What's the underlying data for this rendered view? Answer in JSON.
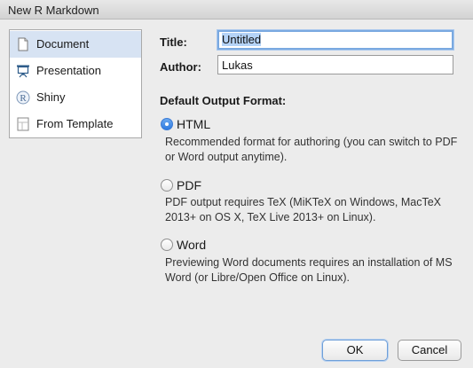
{
  "window": {
    "title": "New R Markdown"
  },
  "sidebar": {
    "items": [
      {
        "label": "Document",
        "icon": "document-icon",
        "selected": true
      },
      {
        "label": "Presentation",
        "icon": "presentation-icon",
        "selected": false
      },
      {
        "label": "Shiny",
        "icon": "shiny-r-icon",
        "selected": false
      },
      {
        "label": "From Template",
        "icon": "template-icon",
        "selected": false
      }
    ]
  },
  "form": {
    "title_label": "Title:",
    "title_value": "Untitled",
    "author_label": "Author:",
    "author_value": "Lukas",
    "output_format_heading": "Default Output Format:"
  },
  "formats": [
    {
      "label": "HTML",
      "checked": true,
      "description": "Recommended format for authoring (you can switch to PDF or Word output anytime)."
    },
    {
      "label": "PDF",
      "checked": false,
      "description": "PDF output requires TeX (MiKTeX on Windows, MacTeX 2013+ on OS X, TeX Live 2013+ on Linux)."
    },
    {
      "label": "Word",
      "checked": false,
      "description": "Previewing Word documents requires an installation of MS Word (or Libre/Open Office on Linux)."
    }
  ],
  "buttons": {
    "ok": "OK",
    "cancel": "Cancel"
  },
  "colors": {
    "selection": "#d7e3f3",
    "accent": "#2f7ae0",
    "background": "#ececec"
  }
}
